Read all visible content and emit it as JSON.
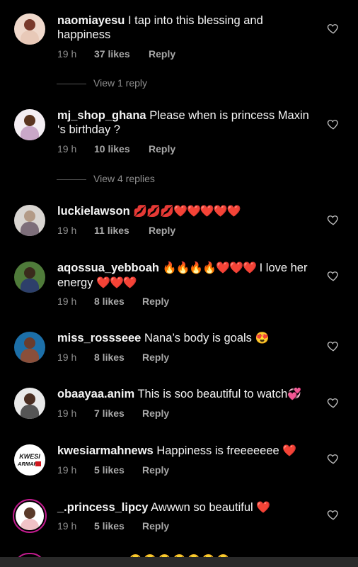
{
  "icons": {
    "like": "heart-outline-icon"
  },
  "comments": [
    {
      "username": "naomiayesu",
      "text": "I tap into this blessing and happiness",
      "emoji": "",
      "text2": "",
      "time": "19 h",
      "likes": "37 likes",
      "reply": "Reply",
      "avatar_colors": [
        "#e8c9b8",
        "#7a3a2c"
      ]
    },
    {
      "username": "mj_shop_ghana",
      "text": "Please when is princess Maxin ‘s birthday ?",
      "emoji": "",
      "text2": "",
      "time": "19 h",
      "likes": "10 likes",
      "reply": "Reply",
      "avatar_colors": [
        "#5a3420",
        "#e9e3e8"
      ]
    },
    {
      "username": "luckielawson",
      "text": "",
      "emoji": "💋💋💋❤️❤️❤️❤️❤️",
      "text2": "",
      "time": "19 h",
      "likes": "11 likes",
      "reply": "Reply",
      "avatar_colors": [
        "#b39a86",
        "#7d6e7a"
      ]
    },
    {
      "username": "aqossua_yebboah",
      "text": "",
      "emoji": "🔥🔥🔥🔥❤️❤️❤️",
      "text2": "I love her energy",
      "emoji2": "❤️❤️❤️",
      "time": "19 h",
      "likes": "8 likes",
      "reply": "Reply",
      "avatar_colors": [
        "#3a2a1c",
        "#4f7b3a"
      ]
    },
    {
      "username": "miss_rossseee",
      "text": "Nana’s body is goals",
      "emoji": "😍",
      "text2": "",
      "time": "19 h",
      "likes": "8 likes",
      "reply": "Reply",
      "avatar_colors": [
        "#6a3c2c",
        "#1c6fa8"
      ]
    },
    {
      "username": "obaayaa.anim",
      "text": "This is soo beautiful to watch",
      "emoji": "💞",
      "text2": "",
      "time": "19 h",
      "likes": "7 likes",
      "reply": "Reply",
      "avatar_colors": [
        "#4a2e22",
        "#dcdcdc"
      ]
    },
    {
      "username": "kwesiarmahnews",
      "text": "Happiness is freeeeeee",
      "emoji": "❤️",
      "text2": "",
      "time": "19 h",
      "likes": "5 likes",
      "reply": "Reply",
      "avatar_label": "KWESI ARMAH",
      "avatar_colors": [
        "#ffffff",
        "#d0161d"
      ]
    },
    {
      "username": "_.princess_lipcy",
      "text": "Awwwn so beautiful",
      "emoji": "❤️",
      "text2": "",
      "time": "19 h",
      "likes": "5 likes",
      "reply": "Reply",
      "avatar_colors": [
        "#5a3a2a",
        "#f0c2c6"
      ]
    }
  ],
  "view_replies": [
    "View 1 reply",
    "View 4 replies"
  ],
  "partial_row_emoji": "😂😂😂😂😂😂😂"
}
